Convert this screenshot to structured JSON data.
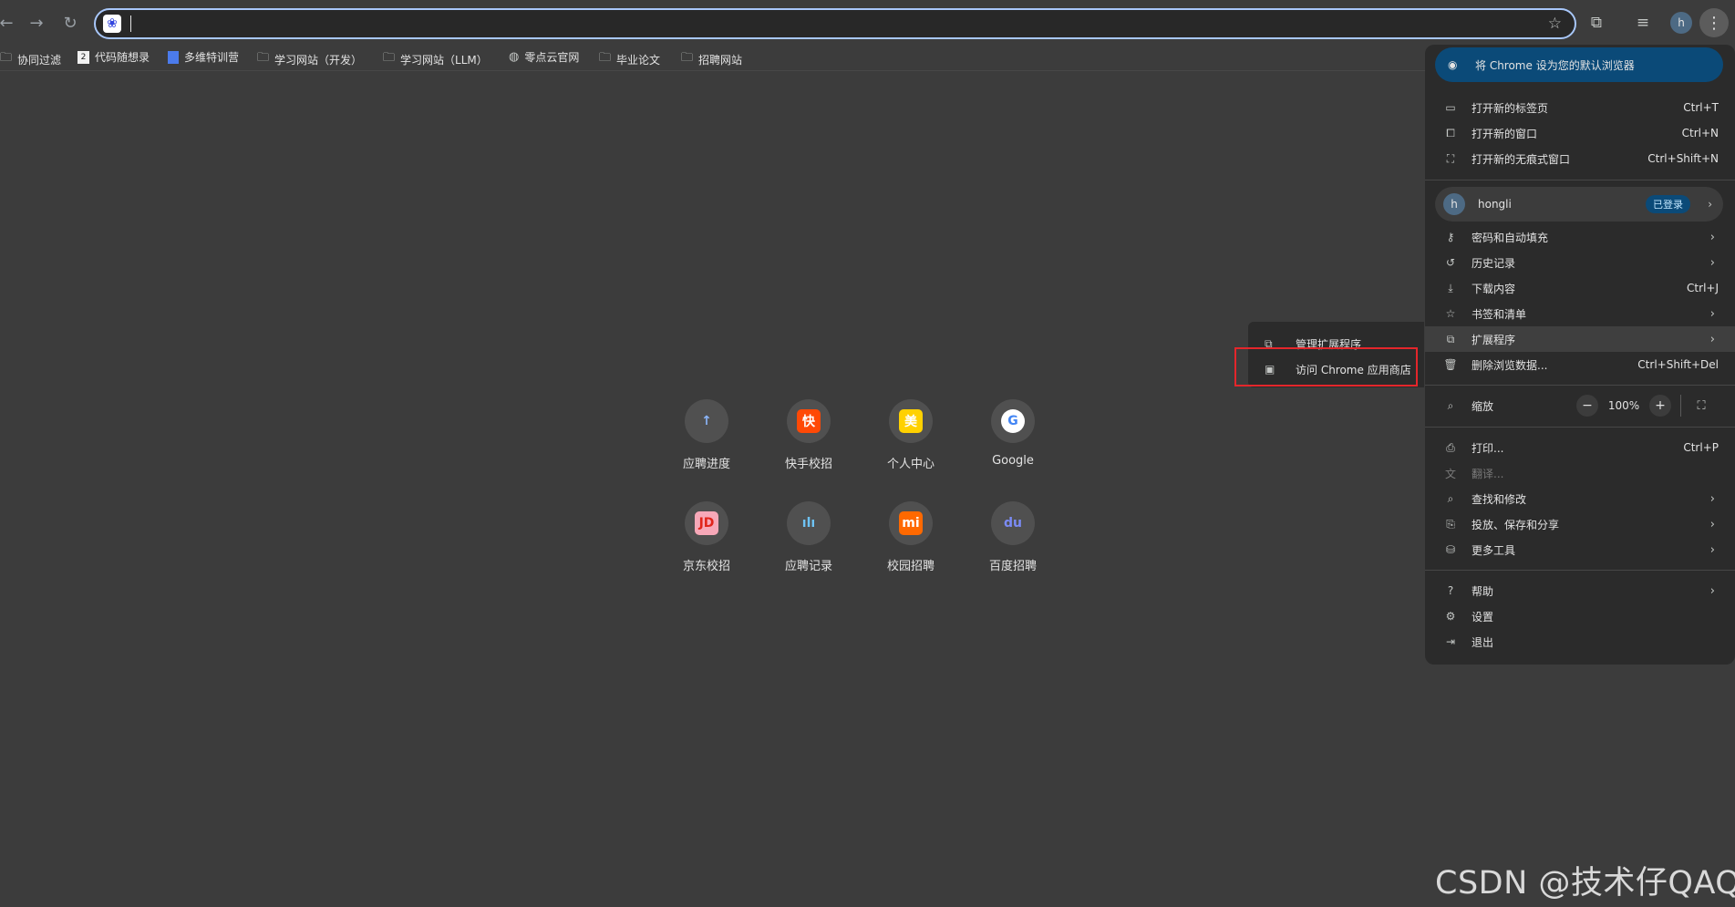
{
  "toolbar": {
    "back_icon": "←",
    "forward_icon": "→",
    "reload_icon": "↻",
    "omnibox_favicon": "❀",
    "bookmark_star": "☆",
    "extensions_icon": "⧉",
    "media_icon": "≡",
    "profile_initial": "h",
    "menu_icon": "⋮"
  },
  "bookmarks": [
    {
      "label": "协同过滤",
      "icon": "folder"
    },
    {
      "label": "代码随想录",
      "icon": "doc"
    },
    {
      "label": "多维特训营",
      "icon": "blue"
    },
    {
      "label": "学习网站（开发）",
      "icon": "folder"
    },
    {
      "label": "学习网站（LLM）",
      "icon": "folder"
    },
    {
      "label": "零点云官网",
      "icon": "globe"
    },
    {
      "label": "毕业论文",
      "icon": "folder"
    },
    {
      "label": "招聘网站",
      "icon": "folder"
    }
  ],
  "shortcuts": [
    {
      "label": "应聘进度",
      "glyph": "↑",
      "bg": "#505050",
      "fg": "#8ab4f8"
    },
    {
      "label": "快手校招",
      "glyph": "快",
      "bg": "#ff4906",
      "fg": "#ffffff"
    },
    {
      "label": "个人中心",
      "glyph": "美",
      "bg": "#ffd100",
      "fg": "#ffffff"
    },
    {
      "label": "Google",
      "glyph": "G",
      "bg": "#ffffff",
      "fg": "#4285f4"
    },
    {
      "label": "京东校招",
      "glyph": "JD",
      "bg": "#f7a8b8",
      "fg": "#e1251b"
    },
    {
      "label": "应聘记录",
      "glyph": "ılı",
      "bg": "#505050",
      "fg": "#6ec3f4"
    },
    {
      "label": "校园招聘",
      "glyph": "mi",
      "bg": "#ff6900",
      "fg": "#ffffff"
    },
    {
      "label": "百度招聘",
      "glyph": "du",
      "bg": "#505050",
      "fg": "#7b8bf5"
    }
  ],
  "submenu": {
    "items": [
      {
        "label": "管理扩展程序",
        "icon": "⧉"
      },
      {
        "label": "访问 Chrome 应用商店",
        "icon": "▣"
      }
    ]
  },
  "menu": {
    "promo": "将 Chrome 设为您的默认浏览器",
    "items": [
      {
        "label": "打开新的标签页",
        "icon": "▭",
        "shortcut": "Ctrl+T"
      },
      {
        "label": "打开新的窗口",
        "icon": "⧠",
        "shortcut": "Ctrl+N"
      },
      {
        "label": "打开新的无痕式窗口",
        "icon": "⛶",
        "shortcut": "Ctrl+Shift+N"
      }
    ],
    "profile": {
      "initial": "h",
      "name": "hongli",
      "badge": "已登录"
    },
    "items2": [
      {
        "label": "密码和自动填充",
        "icon": "⚷"
      },
      {
        "label": "历史记录",
        "icon": "↺"
      },
      {
        "label": "下载内容",
        "icon": "⤓",
        "shortcut": "Ctrl+J"
      },
      {
        "label": "书签和清单",
        "icon": "☆"
      },
      {
        "label": "扩展程序",
        "icon": "⧉"
      },
      {
        "label": "删除浏览数据...",
        "icon": "🗑",
        "shortcut": "Ctrl+Shift+Del"
      }
    ],
    "zoom": {
      "label": "缩放",
      "icon": "⌕",
      "minus": "−",
      "value": "100%",
      "plus": "+",
      "fullscreen": "⛶"
    },
    "items3": [
      {
        "label": "打印...",
        "icon": "⎙",
        "shortcut": "Ctrl+P"
      },
      {
        "label": "翻译...",
        "icon": "文"
      },
      {
        "label": "查找和修改",
        "icon": "⌕"
      },
      {
        "label": "投放、保存和分享",
        "icon": "⎘"
      },
      {
        "label": "更多工具",
        "icon": "⛁"
      }
    ],
    "items4": [
      {
        "label": "帮助",
        "icon": "?"
      },
      {
        "label": "设置",
        "icon": "⚙"
      },
      {
        "label": "退出",
        "icon": "⇥"
      }
    ],
    "chevron": "›"
  },
  "watermark": "CSDN @技术仔QAQ"
}
